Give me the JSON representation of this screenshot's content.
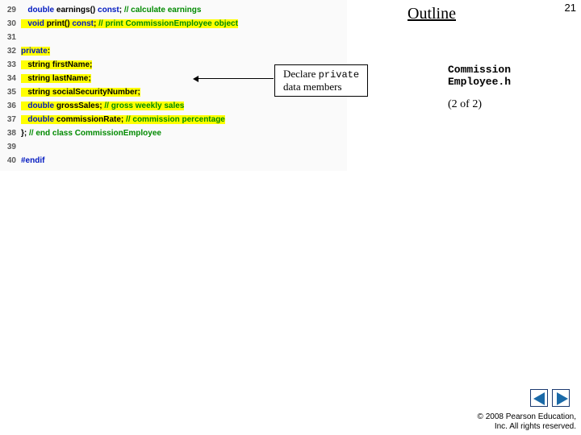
{
  "page_number": "21",
  "outline_heading": "Outline",
  "code": {
    "lines": [
      {
        "n": "29",
        "indent": "   ",
        "tokens": [
          {
            "t": "double ",
            "c": "kw"
          },
          {
            "t": "earnings() ",
            "c": "plain"
          },
          {
            "t": "const",
            "c": "kw"
          },
          {
            "t": "; ",
            "c": "plain"
          },
          {
            "t": "// calculate earnings",
            "c": "cm"
          }
        ]
      },
      {
        "n": "30",
        "indent": "",
        "hl": true,
        "tokens": [
          {
            "t": "   ",
            "c": "plain"
          },
          {
            "t": "void ",
            "c": "kw"
          },
          {
            "t": "print() ",
            "c": "plain"
          },
          {
            "t": "const",
            "c": "kw"
          },
          {
            "t": "; ",
            "c": "plain"
          },
          {
            "t": "// print CommissionEmployee object",
            "c": "cm"
          }
        ]
      },
      {
        "n": "31",
        "indent": "",
        "tokens": []
      },
      {
        "n": "32",
        "indent": "",
        "hl": true,
        "tokens": [
          {
            "t": "private",
            "c": "kw"
          },
          {
            "t": ":",
            "c": "plain"
          }
        ]
      },
      {
        "n": "33",
        "indent": "",
        "hl": true,
        "tokens": [
          {
            "t": "   string firstName;",
            "c": "plain"
          }
        ]
      },
      {
        "n": "34",
        "indent": "",
        "hl": true,
        "tokens": [
          {
            "t": "   string lastName;",
            "c": "plain"
          }
        ]
      },
      {
        "n": "35",
        "indent": "",
        "hl": true,
        "tokens": [
          {
            "t": "   string socialSecurityNumber;",
            "c": "plain"
          }
        ]
      },
      {
        "n": "36",
        "indent": "",
        "hl": true,
        "tokens": [
          {
            "t": "   ",
            "c": "plain"
          },
          {
            "t": "double ",
            "c": "kw"
          },
          {
            "t": "grossSales; ",
            "c": "plain"
          },
          {
            "t": "// gross weekly sales",
            "c": "cm"
          }
        ]
      },
      {
        "n": "37",
        "indent": "",
        "hl": true,
        "tokens": [
          {
            "t": "   ",
            "c": "plain"
          },
          {
            "t": "double ",
            "c": "kw"
          },
          {
            "t": "commissionRate; ",
            "c": "plain"
          },
          {
            "t": "// commission percentage",
            "c": "cm"
          }
        ]
      },
      {
        "n": "38",
        "indent": "",
        "tokens": [
          {
            "t": "}; ",
            "c": "plain"
          },
          {
            "t": "// end class CommissionEmployee",
            "c": "cm"
          }
        ]
      },
      {
        "n": "39",
        "indent": "",
        "tokens": []
      },
      {
        "n": "40",
        "indent": "",
        "tokens": [
          {
            "t": "#endif",
            "c": "pp"
          }
        ]
      }
    ]
  },
  "callout": {
    "line1_a": "Declare ",
    "line1_b": "private",
    "line2": "data members"
  },
  "file_label_1": "Commission",
  "file_label_2": "Employee.h",
  "part_label": "(2 of 2)",
  "copyright_1": "© 2008 Pearson Education,",
  "copyright_2": "Inc.  All rights reserved."
}
